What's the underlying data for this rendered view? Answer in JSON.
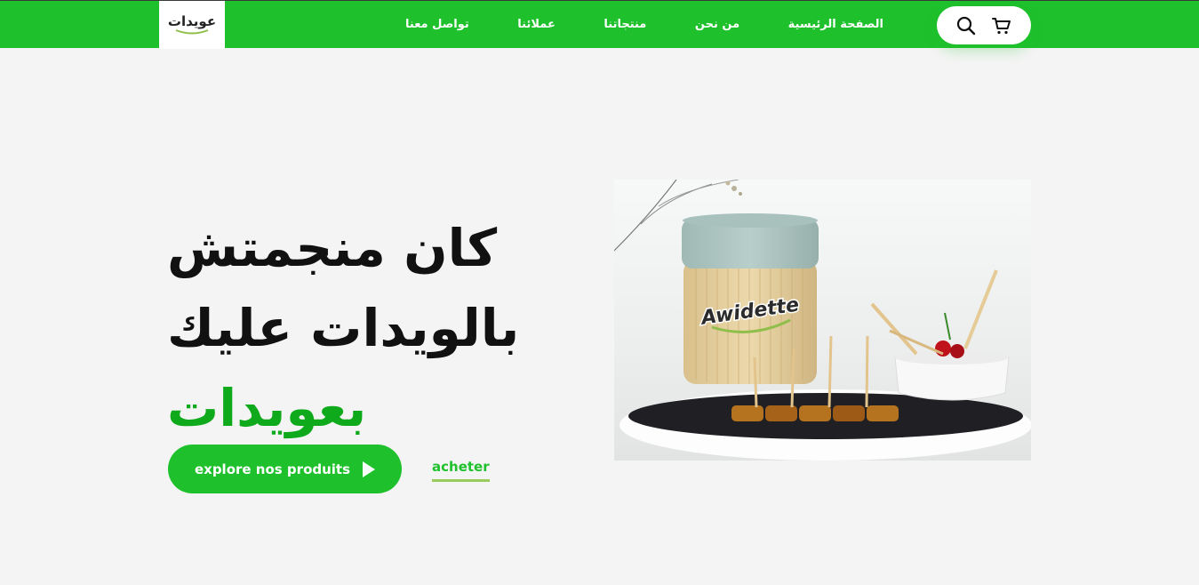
{
  "brand": {
    "logo_text": "عويدات"
  },
  "nav": {
    "links": [
      "الصفحة الرئيسية",
      "من نحن",
      "منتجاتنا",
      "عملائنا",
      "تواصل معنا"
    ]
  },
  "icons": {
    "search": "search-icon",
    "cart": "cart-icon",
    "play": "play-icon"
  },
  "hero": {
    "title_line1": "كان منجمتش",
    "title_line2": "بالويدات عليك",
    "title_line3": "بعويدات",
    "cta_label": "explore nos produits",
    "buy_link": "acheter"
  },
  "product": {
    "jar_label": "Awidette"
  },
  "colors": {
    "brand_green": "#1ec12c",
    "accent_green": "#0eaa1c",
    "underline": "#9acb5f",
    "background": "#f4f4f4"
  }
}
